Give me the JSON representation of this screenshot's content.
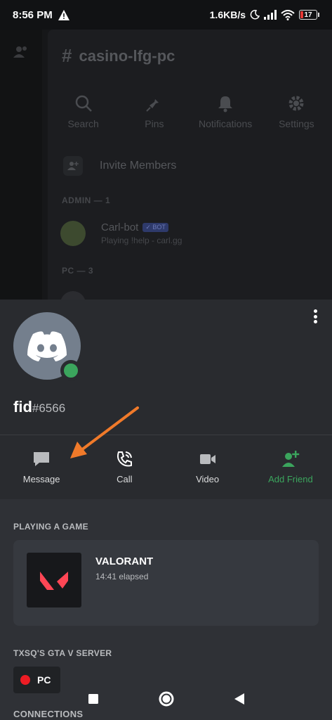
{
  "status_bar": {
    "time": "8:56 PM",
    "network_speed": "1.6KB/s",
    "battery": "17",
    "icons": [
      "warning-icon",
      "moon-icon",
      "signal-icon",
      "wifi-icon",
      "battery-icon"
    ]
  },
  "background": {
    "channel_name": "casino-lfg-pc",
    "tools": [
      "Search",
      "Pins",
      "Notifications",
      "Settings"
    ],
    "invite_label": "Invite Members",
    "admin_section": "ADMIN — 1",
    "member_name": "Carl-bot",
    "member_badge": "✓ BOT",
    "member_status": "Playing !help - carl.gg",
    "pc_section": "PC — 3"
  },
  "profile": {
    "username": "fid",
    "discriminator": "#6566",
    "status_color": "#3ba55d"
  },
  "actions": {
    "message": "Message",
    "call": "Call",
    "video": "Video",
    "add_friend": "Add Friend"
  },
  "activity": {
    "heading": "PLAYING A GAME",
    "game_name": "VALORANT",
    "elapsed": "14:41 elapsed"
  },
  "server": {
    "heading": "TXSQ'S GTA V SERVER",
    "chip_label": "PC"
  },
  "connections": {
    "heading": "CONNECTIONS"
  },
  "colors": {
    "accent_green": "#3ba55d",
    "blurple_avatar": "#747f8d",
    "annotation_arrow": "#f07a2a"
  }
}
